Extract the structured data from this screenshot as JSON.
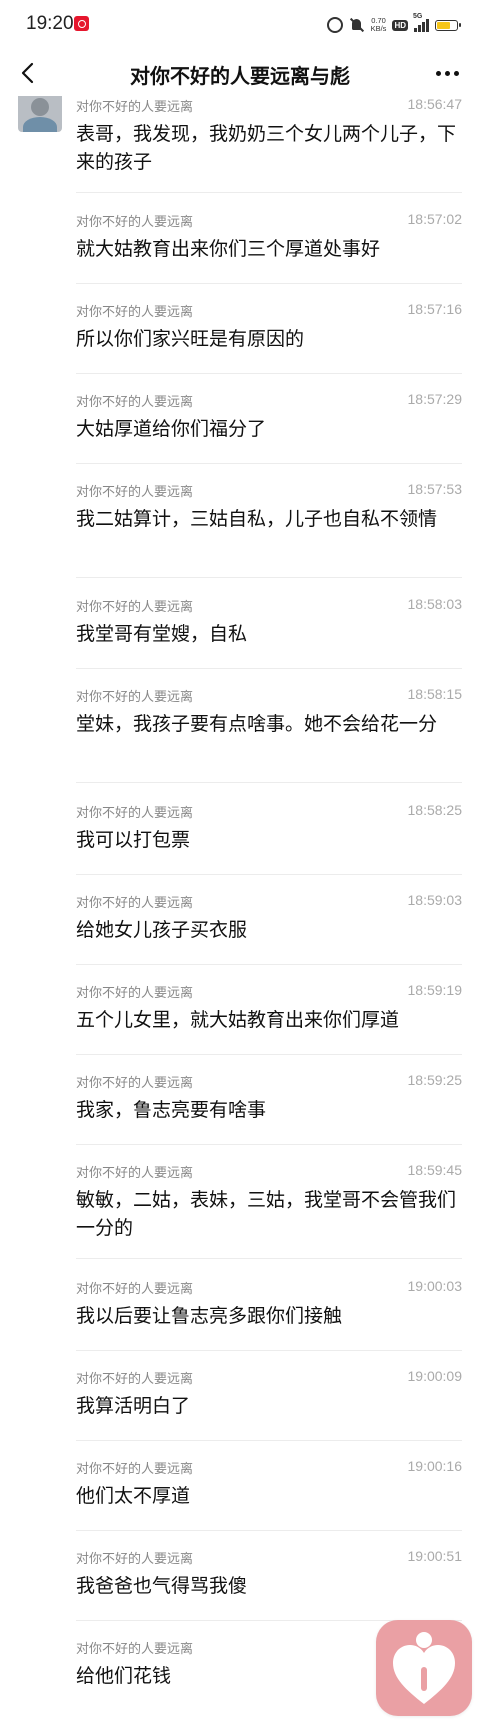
{
  "status_bar": {
    "time": "19:20",
    "net_speed_value": "0.70",
    "net_speed_unit": "KB/s",
    "hd_label": "HD",
    "signal_label": "5G"
  },
  "nav": {
    "title": "对你不好的人要远离与彪"
  },
  "messages": [
    {
      "sender": "对你不好的人要远离",
      "time": "18:56:47",
      "text": "表哥，我发现，我奶奶三个女儿两个儿子，下来的孩子"
    },
    {
      "sender": "对你不好的人要远离",
      "time": "18:57:02",
      "text": "就大姑教育出来你们三个厚道处事好"
    },
    {
      "sender": "对你不好的人要远离",
      "time": "18:57:16",
      "text": "所以你们家兴旺是有原因的"
    },
    {
      "sender": "对你不好的人要远离",
      "time": "18:57:29",
      "text": "大姑厚道给你们福分了"
    },
    {
      "sender": "对你不好的人要远离",
      "time": "18:57:53",
      "text": "我二姑算计，三姑自私，儿子也自私不领情"
    },
    {
      "sender": "对你不好的人要远离",
      "time": "18:58:03",
      "text": "我堂哥有堂嫂，自私"
    },
    {
      "sender": "对你不好的人要远离",
      "time": "18:58:15",
      "text": "堂妹，我孩子要有点啥事。她不会给花一分"
    },
    {
      "sender": "对你不好的人要远离",
      "time": "18:58:25",
      "text": "我可以打包票"
    },
    {
      "sender": "对你不好的人要远离",
      "time": "18:59:03",
      "text": "给她女儿孩子买衣服"
    },
    {
      "sender": "对你不好的人要远离",
      "time": "18:59:19",
      "text": "五个儿女里，就大姑教育出来你们厚道"
    },
    {
      "sender": "对你不好的人要远离",
      "time": "18:59:25",
      "text": "我家，鲁志亮要有啥事"
    },
    {
      "sender": "对你不好的人要远离",
      "time": "18:59:45",
      "text": "敏敏，二姑，表妹，三姑，我堂哥不会管我们一分的"
    },
    {
      "sender": "对你不好的人要远离",
      "time": "19:00:03",
      "text": "我以后要让鲁志亮多跟你们接触"
    },
    {
      "sender": "对你不好的人要远离",
      "time": "19:00:09",
      "text": "我算活明白了"
    },
    {
      "sender": "对你不好的人要远离",
      "time": "19:00:16",
      "text": "他们太不厚道"
    },
    {
      "sender": "对你不好的人要远离",
      "time": "19:00:51",
      "text": "我爸爸也气得骂我傻"
    },
    {
      "sender": "对你不好的人要远离",
      "time": "",
      "text": "给他们花钱"
    }
  ]
}
